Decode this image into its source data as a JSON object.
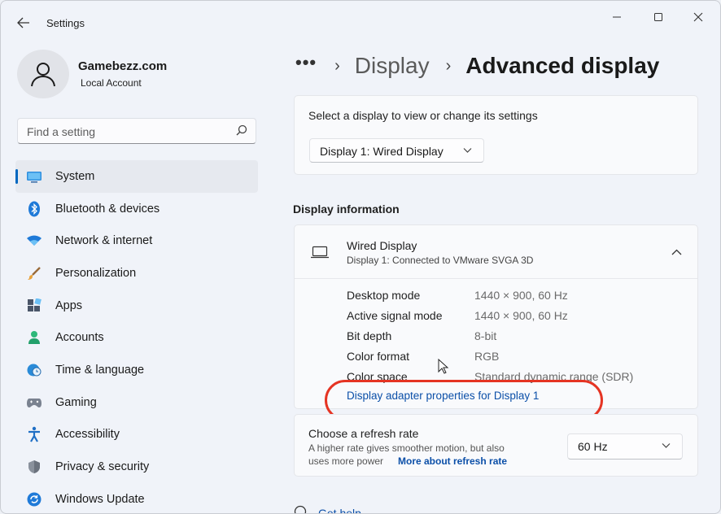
{
  "window": {
    "title": "Settings"
  },
  "profile": {
    "name": "Gamebezz.com",
    "account": "Local Account"
  },
  "search": {
    "placeholder": "Find a setting"
  },
  "sidebar": {
    "items": [
      {
        "label": "System",
        "icon": "system-icon",
        "active": true
      },
      {
        "label": "Bluetooth & devices",
        "icon": "bluetooth-icon"
      },
      {
        "label": "Network & internet",
        "icon": "wifi-icon"
      },
      {
        "label": "Personalization",
        "icon": "brush-icon"
      },
      {
        "label": "Apps",
        "icon": "apps-icon"
      },
      {
        "label": "Accounts",
        "icon": "person-icon"
      },
      {
        "label": "Time & language",
        "icon": "globe-clock-icon"
      },
      {
        "label": "Gaming",
        "icon": "controller-icon"
      },
      {
        "label": "Accessibility",
        "icon": "accessibility-icon"
      },
      {
        "label": "Privacy & security",
        "icon": "shield-icon"
      },
      {
        "label": "Windows Update",
        "icon": "update-icon"
      }
    ]
  },
  "breadcrumb": {
    "overflow": "•••",
    "parent": "Display",
    "current": "Advanced display"
  },
  "display_select": {
    "prompt": "Select a display to view or change its settings",
    "selected": "Display 1: Wired Display"
  },
  "display_info": {
    "section_title": "Display information",
    "title": "Wired Display",
    "subtitle": "Display 1: Connected to VMware SVGA 3D",
    "rows": [
      {
        "key": "Desktop mode",
        "value": "1440 × 900, 60 Hz"
      },
      {
        "key": "Active signal mode",
        "value": "1440 × 900, 60 Hz"
      },
      {
        "key": "Bit depth",
        "value": "8-bit"
      },
      {
        "key": "Color format",
        "value": "RGB"
      },
      {
        "key": "Color space",
        "value": "Standard dynamic range (SDR)"
      }
    ],
    "adapter_link": "Display adapter properties for Display 1"
  },
  "refresh_rate": {
    "title": "Choose a refresh rate",
    "desc_line1": "A higher rate gives smoother motion, but also",
    "desc_line2": "uses more power",
    "link": "More about refresh rate",
    "selected": "60 Hz"
  },
  "help": {
    "label": "Get help"
  },
  "colors": {
    "accent": "#0067c0",
    "link": "#0b4fa8",
    "highlight": "#e53423"
  }
}
